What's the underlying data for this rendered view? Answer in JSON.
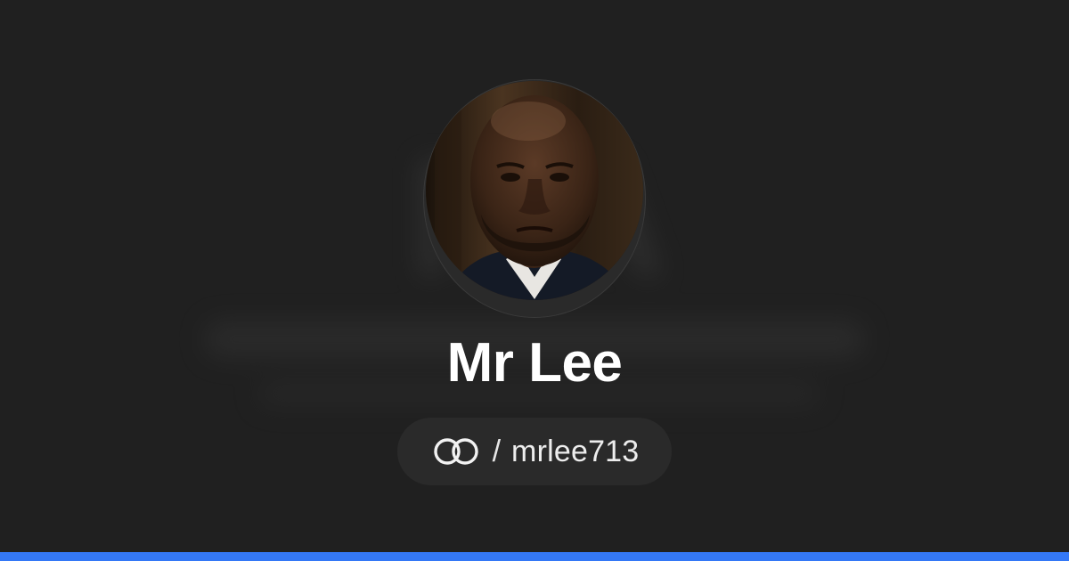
{
  "profile": {
    "name": "Mr Lee",
    "handle_separator": "/",
    "handle": "mrlee713"
  },
  "icons": {
    "brand_logo": "linked-rings-icon",
    "avatar": "person-portrait"
  },
  "colors": {
    "background": "#202020",
    "pill_background": "#2a2a2a",
    "name_text": "#ffffff",
    "accent_bar": "#3478f6"
  }
}
